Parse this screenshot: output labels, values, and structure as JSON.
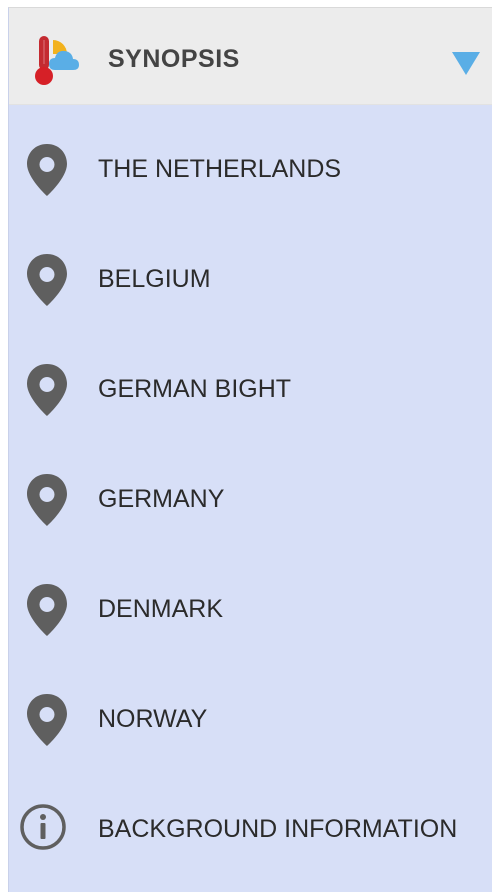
{
  "menu": {
    "header": {
      "title": "SYNOPSIS",
      "icon": "weather-thermometer-icon",
      "toggle_icon": "triangle-down-icon",
      "accent_color": "#5aaee6"
    },
    "items": [
      {
        "label": "THE NETHERLANDS",
        "icon": "map-pin-icon"
      },
      {
        "label": "BELGIUM",
        "icon": "map-pin-icon"
      },
      {
        "label": "GERMAN BIGHT",
        "icon": "map-pin-icon"
      },
      {
        "label": "GERMANY",
        "icon": "map-pin-icon"
      },
      {
        "label": "DENMARK",
        "icon": "map-pin-icon"
      },
      {
        "label": "NORWAY",
        "icon": "map-pin-icon"
      },
      {
        "label": "BACKGROUND INFORMATION",
        "icon": "info-icon"
      }
    ],
    "colors": {
      "panel_background": "#d7dff7",
      "header_background": "#ececec",
      "icon_color": "#5f5f5f"
    }
  }
}
